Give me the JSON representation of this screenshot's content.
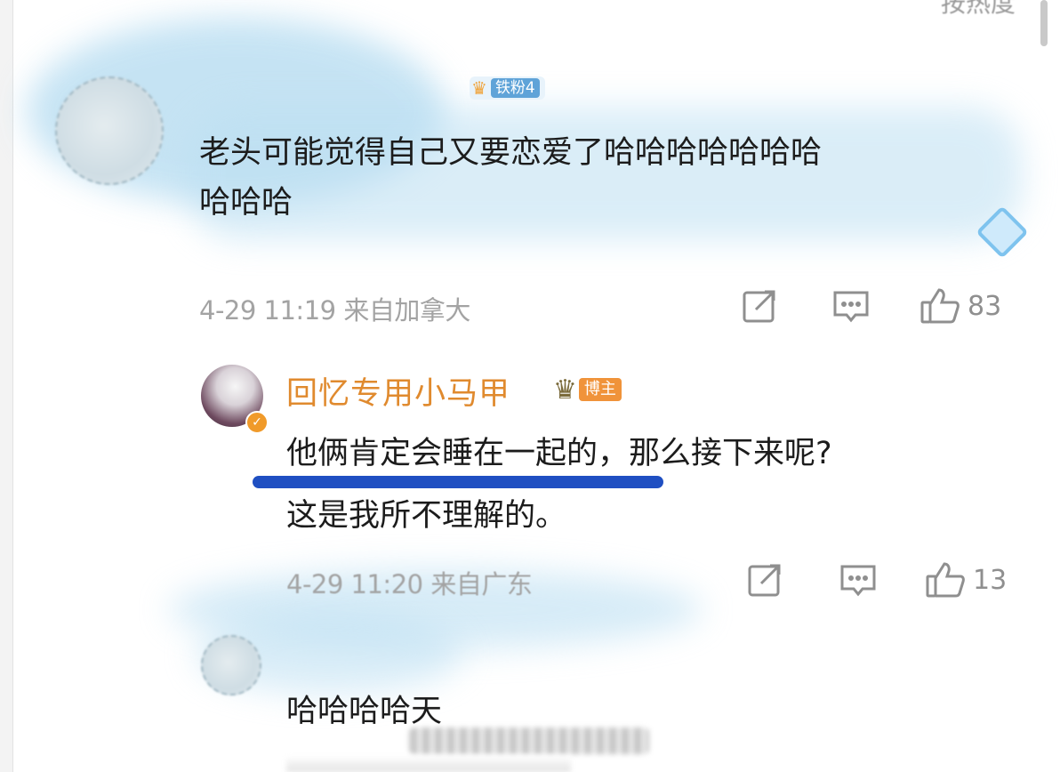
{
  "header": {
    "sort_label": "按热度"
  },
  "comment1": {
    "fan_badge": "铁粉4",
    "text": "老头可能觉得自己又要恋爱了哈哈哈哈哈哈哈哈哈哈",
    "line1": "老头可能觉得自己又要恋爱了哈哈哈哈哈哈哈",
    "line2": "哈哈哈",
    "time_location": "4-29 11:19 来自加拿大",
    "likes": "83"
  },
  "reply": {
    "username": "回忆专用小马甲",
    "role_badge": "博主",
    "line1": "他俩肯定会睡在一起的，那么接下来呢?",
    "line2": "这是我所不理解的。",
    "time_location": "4-29 11:20 来自广东",
    "likes": "13"
  },
  "comment3": {
    "text": "哈哈哈哈天"
  },
  "icons": {
    "share": "share-icon",
    "comment": "comment-icon",
    "like": "thumbs-up-icon",
    "diamond": "diamond-icon"
  },
  "colors": {
    "username": "#e08a2e",
    "blogger_badge": "#f0933a",
    "underline": "#1f4fc2",
    "meta": "#a3a3a3"
  }
}
